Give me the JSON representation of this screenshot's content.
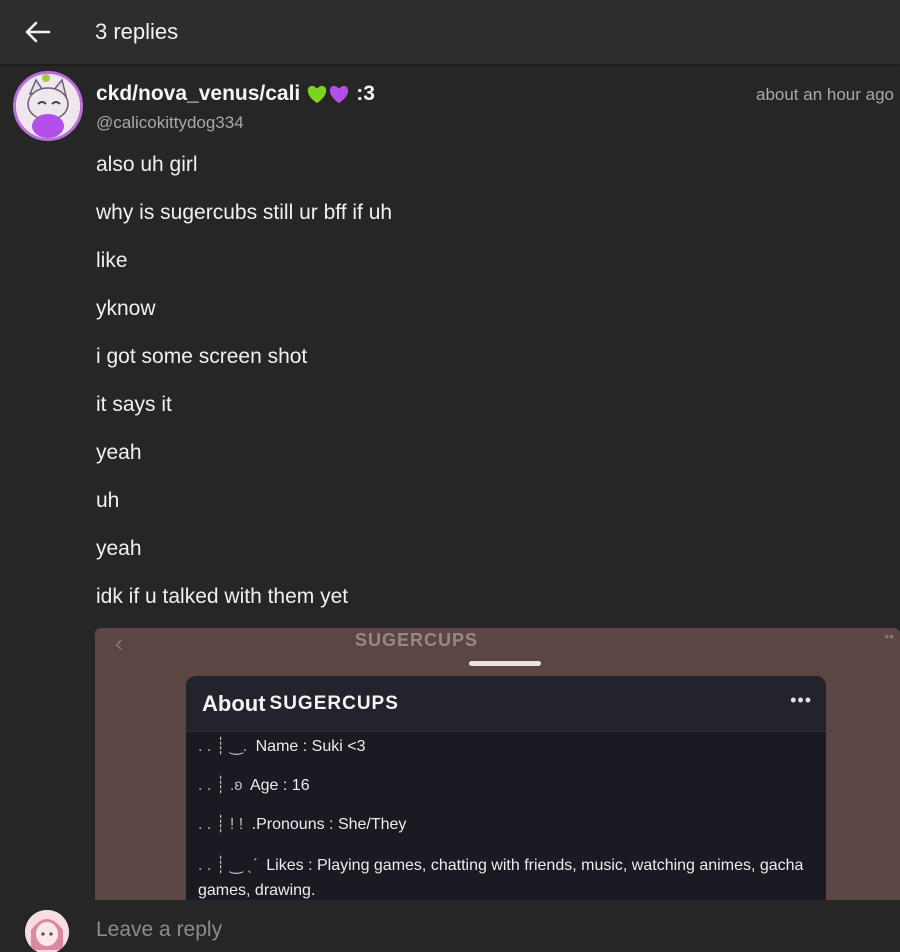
{
  "header": {
    "title": "3 replies",
    "back_icon": "arrow-left-icon"
  },
  "post": {
    "author_name": "ckd/nova_venus/cali",
    "author_suffix": ":3",
    "author_emojis": [
      "green-heart-icon",
      "purple-heart-icon"
    ],
    "handle": "@calicokittydog334",
    "timestamp": "about an hour ago",
    "messages": [
      "also uh girl",
      "why is sugercubs still ur bff if uh",
      "like",
      "yknow",
      "i got some screen shot",
      "it says it",
      "yeah",
      "uh",
      "yeah",
      "idk if u talked with them yet"
    ]
  },
  "attachment": {
    "top_title": "SUGERCUPS",
    "card": {
      "title": "About",
      "title_name": "SUGERCUPS",
      "more_label": "•••",
      "rows": [
        {
          "prefix": ". . ┊ ‿.",
          "label": "Name :",
          "value": "Suki <3"
        },
        {
          "prefix": ". . ┊ .ʚ",
          "label": "Age :",
          "value": "16"
        },
        {
          "prefix": ". . ┊ ! !",
          "label": ".Pronouns :",
          "value": "She/They"
        },
        {
          "prefix": ". . ┊ ‿ ˎˊ",
          "label": "Likes :",
          "value": "Playing games, chatting with friends, music, watching animes, gacha games, drawing."
        }
      ]
    }
  },
  "reply": {
    "placeholder": "Leave a reply"
  },
  "colors": {
    "background": "#262626",
    "header": "#2d2d2d",
    "attachment_bg": "#5c4643",
    "card_bg": "#1a1a22",
    "avatar_border": "#b86fd6",
    "green_heart": "#7ed321",
    "purple_heart": "#b44ee8"
  }
}
